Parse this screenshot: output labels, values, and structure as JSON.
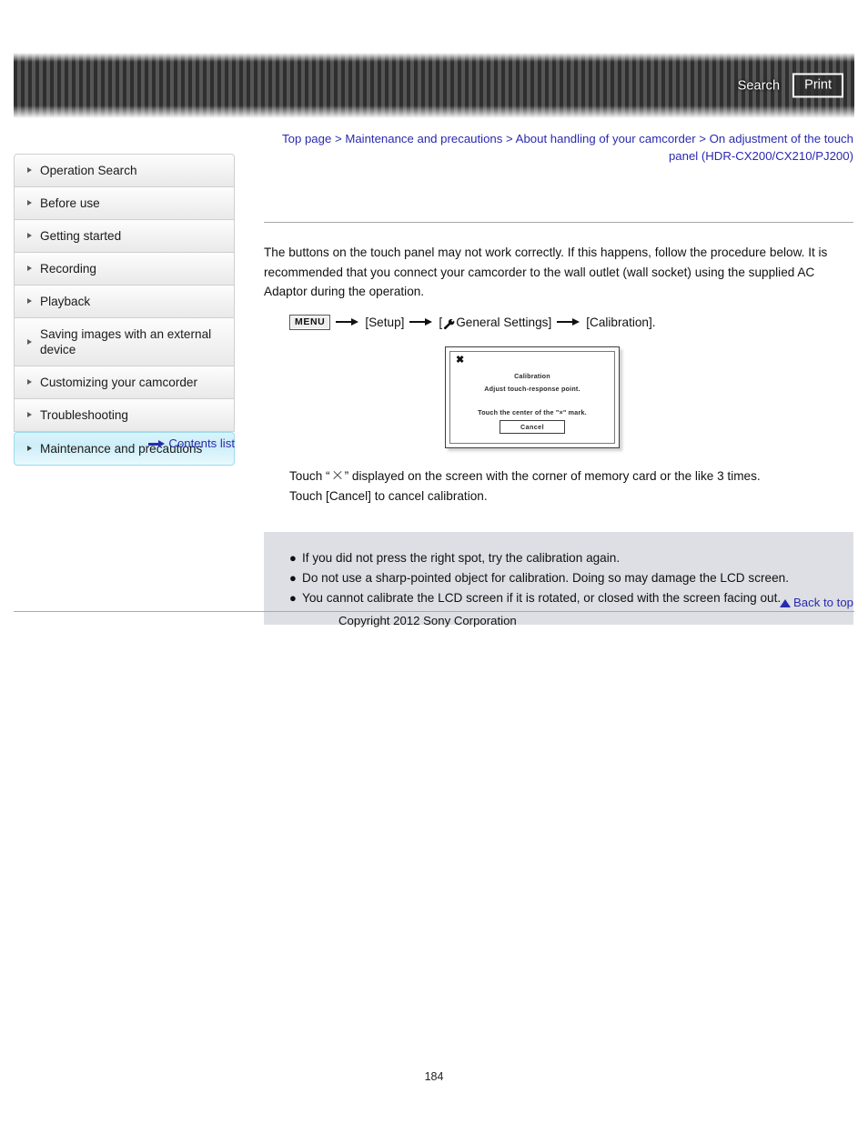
{
  "header": {
    "search_label": "Search",
    "print_label": "Print",
    "icons": {
      "banner": "striped-banner"
    }
  },
  "breadcrumb": {
    "full": "Top page > Maintenance and precautions > About handling of your camcorder > On adjustment of the touch panel (HDR-CX200/CX210/PJ200)",
    "items": [
      "Top page",
      "Maintenance and precautions",
      "About handling of your camcorder",
      "On adjustment of the touch panel (HDR-CX200/CX210/PJ200)"
    ],
    "separator": " > "
  },
  "sidebar": {
    "items": [
      {
        "label": "Operation Search",
        "active": false
      },
      {
        "label": "Before use",
        "active": false
      },
      {
        "label": "Getting started",
        "active": false
      },
      {
        "label": "Recording",
        "active": false
      },
      {
        "label": "Playback",
        "active": false
      },
      {
        "label": "Saving images with an external device",
        "active": false
      },
      {
        "label": "Customizing your camcorder",
        "active": false
      },
      {
        "label": "Troubleshooting",
        "active": false
      },
      {
        "label": "Maintenance and precautions",
        "active": true
      }
    ],
    "contents_link": "Contents list"
  },
  "main": {
    "intro": "The buttons on the touch panel may not work correctly. If this happens, follow the procedure below. It is recommended that you connect your camcorder to the wall outlet (wall socket) using the supplied AC Adaptor during the operation.",
    "menu_path": {
      "menu_chip": "MENU",
      "step1": "[Setup]",
      "step2_prefix": "[",
      "step2": "General Settings]",
      "step3": "[Calibration]."
    },
    "calibration_image": {
      "close_glyph": "✖",
      "title": "Calibration",
      "subtitle": "Adjust touch-response point.",
      "instruction": "Touch the center of the \"×\" mark.",
      "cancel_label": "Cancel"
    },
    "after_image": {
      "line1_before": "Touch “",
      "line1_after": "” displayed on the screen with the corner of memory card or the like 3 times.",
      "line2": "Touch [Cancel] to cancel calibration."
    },
    "notes": [
      "If you did not press the right spot, try the calibration again.",
      "Do not use a sharp-pointed object for calibration. Doing so may damage the LCD screen.",
      "You cannot calibrate the LCD screen if it is rotated, or closed with the screen facing out."
    ],
    "note_bullet": "●"
  },
  "footer": {
    "back_to_top": "Back to top",
    "copyright": "Copyright 2012 Sony Corporation",
    "page_number": "184"
  },
  "colors": {
    "link": "#2a2ab0",
    "active_item": "#cdeef8",
    "notes_bg": "#dddfe4",
    "rule": "#a9a9a9"
  }
}
